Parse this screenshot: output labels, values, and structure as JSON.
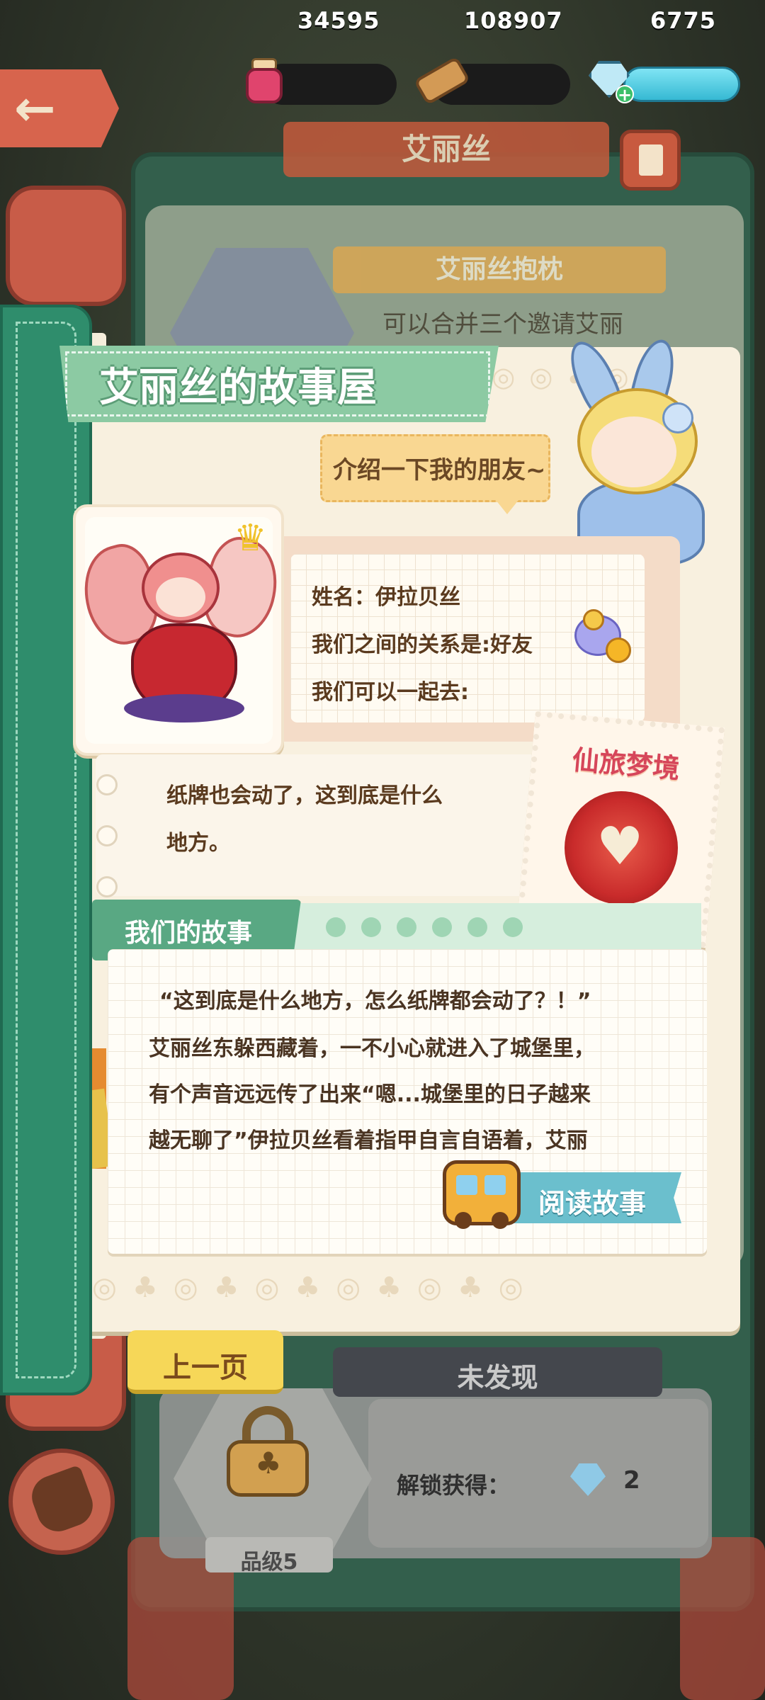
{
  "header": {
    "character_banner": "艾丽丝",
    "resources": {
      "ink": "34595",
      "wood": "108907",
      "gems": "6775"
    }
  },
  "background_card": {
    "subtitle": "艾丽丝抱枕",
    "description": "可以合并三个邀请艾丽"
  },
  "story_house": {
    "title": "艾丽丝的故事屋",
    "speech": "介绍一下我的朋友~",
    "friend": {
      "name_line": "姓名：伊拉贝丝",
      "relation_line": "我们之间的关系是:好友",
      "together_line": "我们可以一起去:"
    },
    "snippet_lines": [
      "纸牌也会动了，这到底是什么",
      "地方。"
    ],
    "destination": "仙旅梦境",
    "story_label": "我们的故事",
    "story_lines": [
      "“这到底是什么地方，怎么纸牌都会动了？！”",
      "艾丽丝东躲西藏着，一不小心就进入了城堡里，",
      "有个声音远远传了出来“嗯...城堡里的日子越来",
      "越无聊了”伊拉贝丝看着指甲自言自语着，艾丽"
    ],
    "read_button": "阅读故事"
  },
  "footer": {
    "prev_page": "上一页",
    "undiscovered": "未发现",
    "unlock_label": "解锁获得：",
    "unlock_count": "2",
    "grade": "品级5"
  },
  "icons": [
    "back-arrow-icon",
    "ink-jar-icon",
    "wood-plank-icon",
    "gem-icon",
    "plus-icon",
    "book-icon",
    "lock-icon",
    "bus-icon",
    "hand-icon"
  ]
}
